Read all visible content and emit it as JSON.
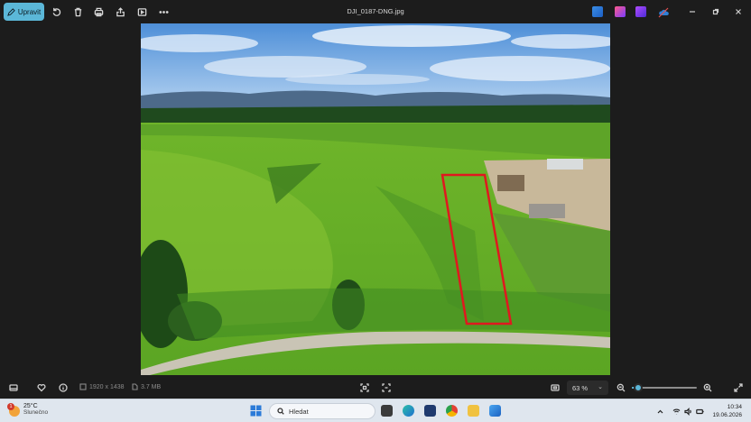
{
  "toolbar": {
    "edit_label": "Upravit",
    "filename": "DJI_0187-DNG.jpg"
  },
  "info": {
    "dimensions": "1920 x 1438",
    "filesize": "3.7 MB",
    "zoom": "63 %",
    "zoom_level": 0.1
  },
  "taskbar": {
    "temperature": "25°C",
    "weather": "Slunečno",
    "weather_badge": "1",
    "search_placeholder": "Hledat",
    "time": "10:34",
    "date": "19.06.2026"
  },
  "colors": {
    "accent": "#5bb7d8",
    "annotation": "#e0181f"
  }
}
